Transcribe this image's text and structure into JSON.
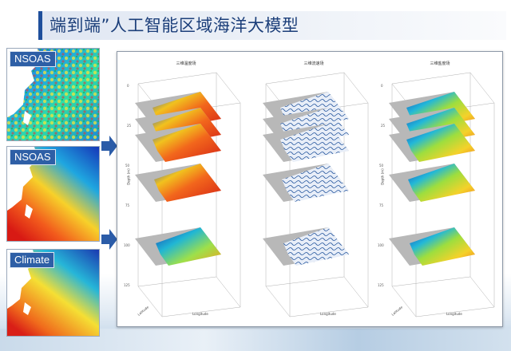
{
  "title": "端到端”人工智能区域海洋大模型",
  "maps": [
    {
      "label": "NSOAS"
    },
    {
      "label": "NSOAS"
    },
    {
      "label": "Climate"
    }
  ],
  "panels": [
    {
      "title": "三维温度场",
      "ylabel": "Depth (m)",
      "xlabel": "Longitude",
      "zlabel": "Latitude"
    },
    {
      "title": "三维流速场",
      "ylabel": "",
      "xlabel": "Longitude",
      "zlabel": ""
    },
    {
      "title": "三维盐度场",
      "ylabel": "Depth (m)",
      "xlabel": "Longitude",
      "zlabel": "Latitude"
    }
  ],
  "colors": {
    "accent": "#1f4f9c",
    "arrow": "#2b5ca8",
    "label_bg": "#2e5fa6"
  }
}
